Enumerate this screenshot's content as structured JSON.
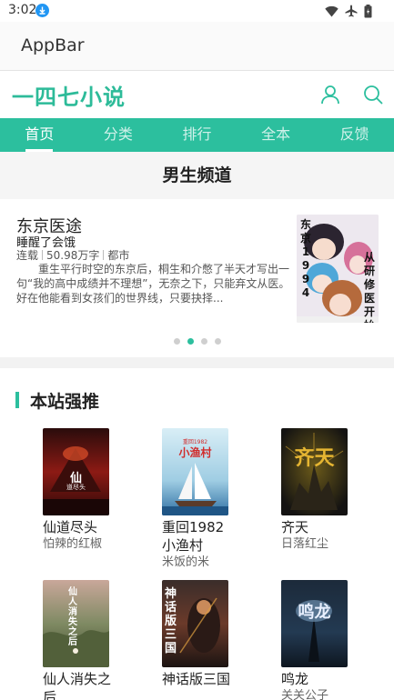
{
  "status": {
    "time": "3:02"
  },
  "appbar": {
    "title": "AppBar"
  },
  "header": {
    "logo": "一四七小说"
  },
  "nav": {
    "items": [
      {
        "label": "首页",
        "active": true
      },
      {
        "label": "分类"
      },
      {
        "label": "排行"
      },
      {
        "label": "全本"
      },
      {
        "label": "反馈"
      }
    ]
  },
  "channel": {
    "title": "男生频道"
  },
  "featured": {
    "title": "东京医途",
    "author": "睡醒了会饿",
    "status": "连载",
    "words": "50.98万字",
    "category": "都市",
    "description": "重生平行时空的东京后，桐生和介憋了半天才写出一句“我的高中成绩并不理想”，无奈之下，只能弃文从医。好在他能看到女孩们的世界线，只要抉择...",
    "cover_text": [
      "东",
      "京",
      "1",
      "9",
      "9",
      "4",
      "从",
      "研",
      "修",
      "医",
      "开",
      "始"
    ]
  },
  "carousel": {
    "count": 4,
    "active_index": 1
  },
  "recommend": {
    "title": "本站强推",
    "books": [
      {
        "title": "仙道尽头",
        "author": "怕辣的红椒",
        "cover_text": "仙",
        "cover_sub": "道尽头"
      },
      {
        "title": "重回1982小渔村",
        "author": "米饭的米",
        "cover_text": "小渔村",
        "cover_sub": "重回1982"
      },
      {
        "title": "齐天",
        "author": "日落红尘",
        "cover_text": "齐天",
        "cover_sub": ""
      },
      {
        "title": "仙人消失之后",
        "author": "",
        "cover_text": "仙人消失之后",
        "cover_sub": ""
      },
      {
        "title": "神话版三国",
        "author": "",
        "cover_text": "神话版三国",
        "cover_sub": ""
      },
      {
        "title": "鸣龙",
        "author": "关关公子",
        "cover_text": "鸣龙",
        "cover_sub": ""
      }
    ]
  },
  "colors": {
    "accent": "#2cbf9e",
    "logo": "#2dbb99"
  }
}
